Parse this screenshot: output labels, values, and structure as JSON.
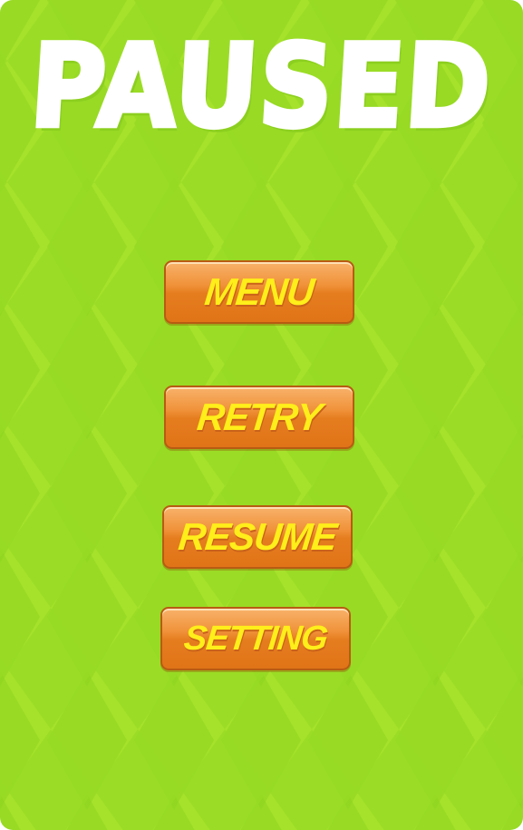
{
  "title": "PAUSED",
  "buttons": {
    "menu": "MENU",
    "retry": "RETRY",
    "resume": "RESUME",
    "setting": "SETTING"
  },
  "colors": {
    "background": "#a6e22c",
    "button": "#e57d1f",
    "button_text": "#ffee1a",
    "title": "#ffffff"
  }
}
